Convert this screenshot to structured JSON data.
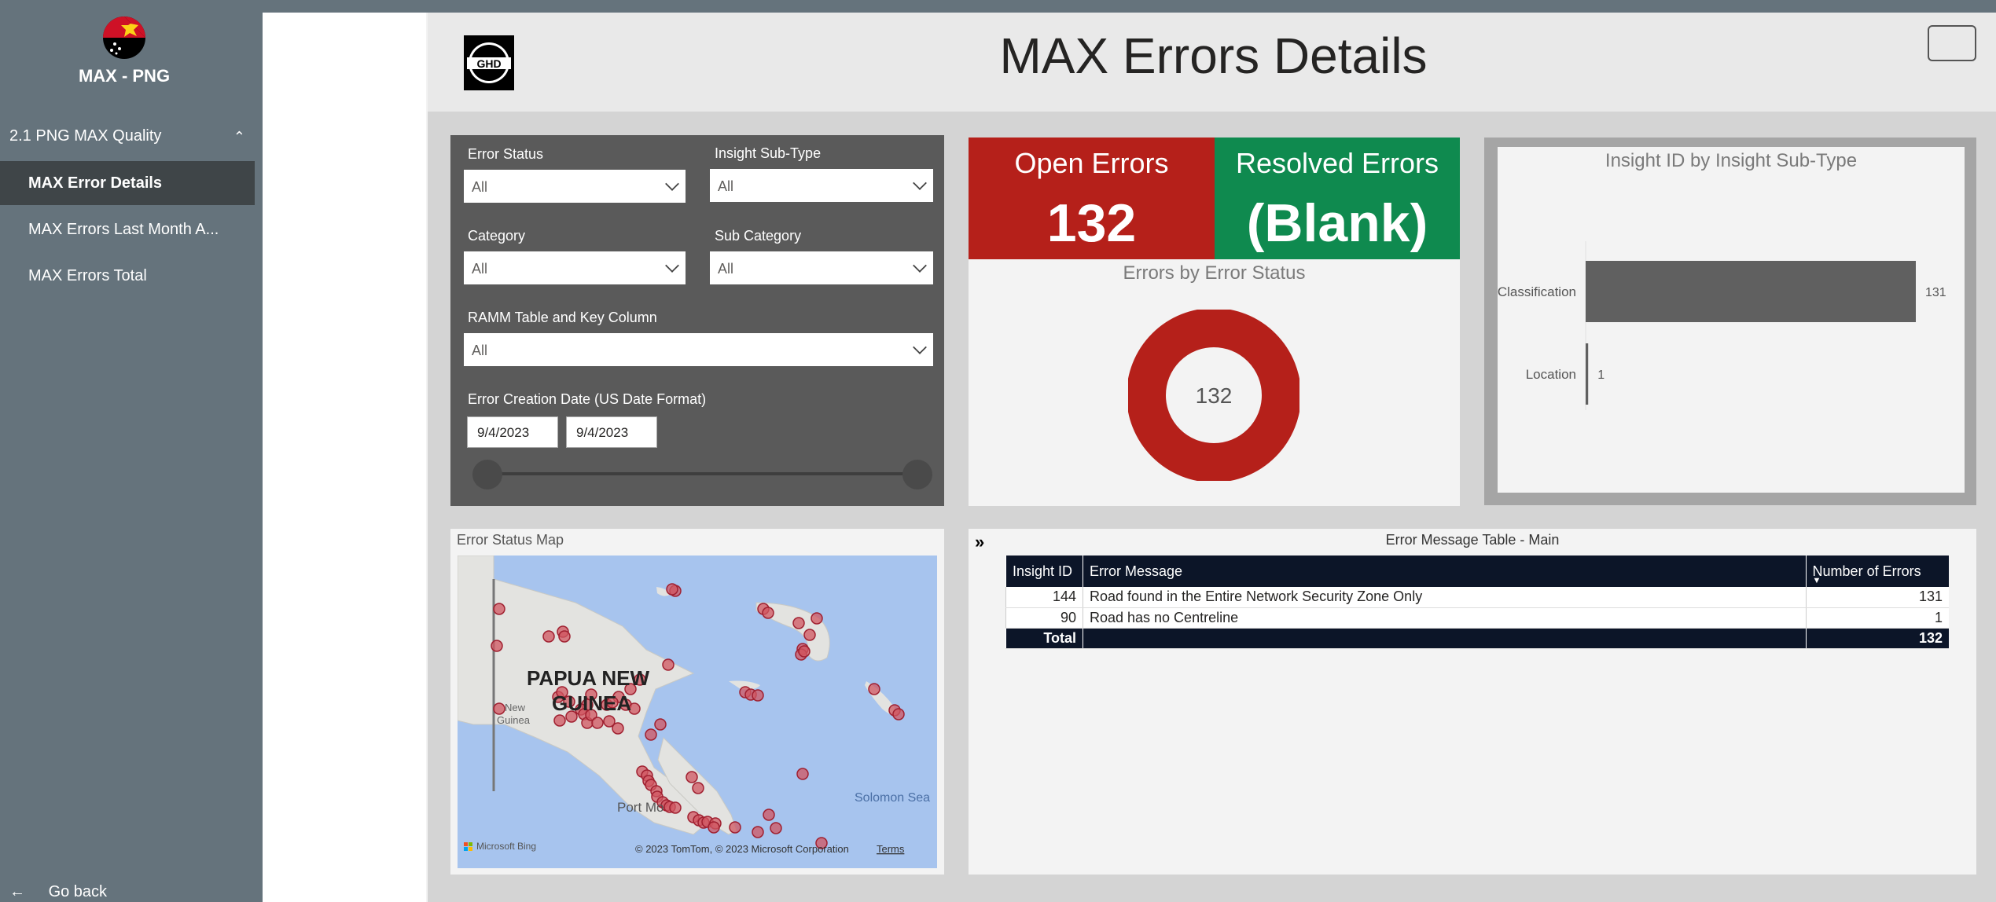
{
  "sidebar": {
    "app_title": "MAX - PNG",
    "section": "2.1 PNG MAX Quality",
    "items": [
      {
        "label": "MAX Error Details",
        "active": true
      },
      {
        "label": "MAX Errors Last Month A..."
      },
      {
        "label": "MAX Errors Total"
      }
    ],
    "go_back": "Go back"
  },
  "header": {
    "logo_text": "GHD",
    "title": "MAX Errors Details"
  },
  "filters": {
    "error_status": {
      "label": "Error Status",
      "value": "All"
    },
    "insight_sub_type": {
      "label": "Insight Sub-Type",
      "value": "All"
    },
    "category": {
      "label": "Category",
      "value": "All"
    },
    "sub_category": {
      "label": "Sub Category",
      "value": "All"
    },
    "ramm_table": {
      "label": "RAMM Table and Key Column",
      "value": "All"
    },
    "date": {
      "label": "Error Creation Date (US Date Format)",
      "start": "9/4/2023",
      "end": "9/4/2023"
    }
  },
  "cards": {
    "open_label": "Open Errors",
    "open_value": "132",
    "resolved_label": "Resolved Errors",
    "resolved_value": "(Blank)"
  },
  "donut": {
    "title": "Errors by Error Status",
    "center": "132",
    "color": "#b5201a"
  },
  "bar_chart": {
    "title": "Insight ID by Insight Sub-Type"
  },
  "chart_data": {
    "type": "bar",
    "orientation": "horizontal",
    "title": "Insight ID by Insight Sub-Type",
    "categories": [
      "Classification",
      "Location"
    ],
    "values": [
      131,
      1
    ],
    "value_labels": [
      "131",
      "1"
    ],
    "xlim": [
      0,
      131
    ],
    "color": "#606060",
    "grid": false
  },
  "map": {
    "title": "Error Status Map",
    "label_country": "PAPUA NEW",
    "label_country2": "GUINEA",
    "label_ng1": "New",
    "label_ng2": "Guinea",
    "label_port": "Port Mo",
    "label_sea": "Solomon Sea",
    "bing": "Microsoft Bing",
    "copyright": "© 2023 TomTom, © 2023 Microsoft Corporation",
    "terms": "Terms"
  },
  "table": {
    "title": "Error Message Table - Main",
    "columns": [
      "Insight ID",
      "Error Message",
      "Number of Errors"
    ],
    "rows": [
      {
        "id": "144",
        "message": "Road found in the Entire Network Security Zone Only",
        "count": "131"
      },
      {
        "id": "90",
        "message": "Road has no Centreline",
        "count": "1"
      }
    ],
    "total_label": "Total",
    "total_count": "132"
  }
}
